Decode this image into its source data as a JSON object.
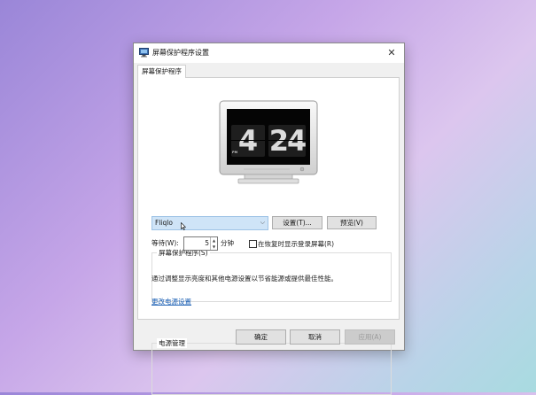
{
  "window": {
    "title": "屏幕保护程序设置",
    "close_glyph": "✕"
  },
  "tab": {
    "label": "屏幕保护程序"
  },
  "preview": {
    "hour": "4",
    "minutes": "24",
    "ampm": "PM"
  },
  "screensaver_group": {
    "label": "屏幕保护程序(S)",
    "selected": "Fliqlo",
    "dropdown_arrow": "⌵",
    "settings_button": "设置(T)...",
    "preview_button": "预览(V)",
    "wait_label": "等待(W):",
    "wait_value": "5",
    "wait_unit": "分钟",
    "resume_checkbox_label": "在恢复时显示登录屏幕(R)",
    "resume_checked": false
  },
  "power_group": {
    "label": "电源管理",
    "description": "通过调整显示亮度和其他电源设置以节省能源或提供最佳性能。",
    "link": "更改电源设置"
  },
  "footer": {
    "ok": "确定",
    "cancel": "取消",
    "apply": "应用(A)"
  },
  "icons": [
    "screensaver-app-icon",
    "close-icon",
    "chevron-down-icon",
    "spin-up-icon",
    "spin-down-icon",
    "mouse-cursor-icon"
  ]
}
